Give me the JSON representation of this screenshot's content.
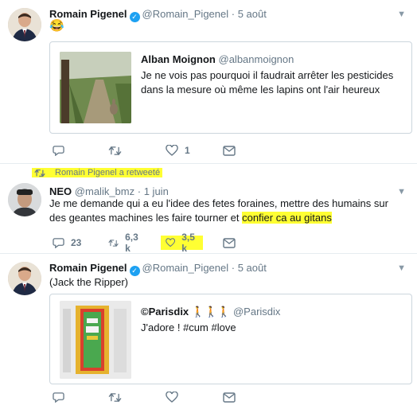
{
  "tweets": [
    {
      "name": "Romain Pigenel",
      "handle": "@Romain_Pigenel",
      "sep": "·",
      "time": "5 août",
      "text": "😂",
      "quote": {
        "name": "Alban Moignon",
        "handle": "@albanmoignon",
        "text": "Je ne vois pas pourquoi il faudrait arrêter les pesticides dans la mesure où même les lapins ont l'air heureux"
      },
      "actions": {
        "reply": "",
        "retweet": "",
        "like": "1"
      }
    },
    {
      "retweet_banner": "Romain Pigenel a retweeté",
      "name": "NEO",
      "handle": "@malik_bmz",
      "sep": "·",
      "time": "1 juin",
      "text_plain": "Je me demande qui a eu l'idee des fetes foraines, mettre des humains sur des geantes machines les faire tourner et ",
      "text_highlight": "confier ca au gitans",
      "actions": {
        "reply": "23",
        "retweet": "6,3 k",
        "like": "3,5 k"
      }
    },
    {
      "name": "Romain Pigenel",
      "handle": "@Romain_Pigenel",
      "sep": "·",
      "time": "5 août",
      "text": "(Jack the Ripper)",
      "quote": {
        "name": "©Parisdix",
        "emoji": "🚶🚶🚶",
        "handle": "@Parisdix",
        "text": "J'adore ! #cum #love"
      },
      "actions": {
        "reply": "",
        "retweet": "",
        "like": ""
      }
    }
  ],
  "colors": {
    "highlight": "#ffff33",
    "verified": "#1da1f2",
    "muted": "#657786"
  }
}
